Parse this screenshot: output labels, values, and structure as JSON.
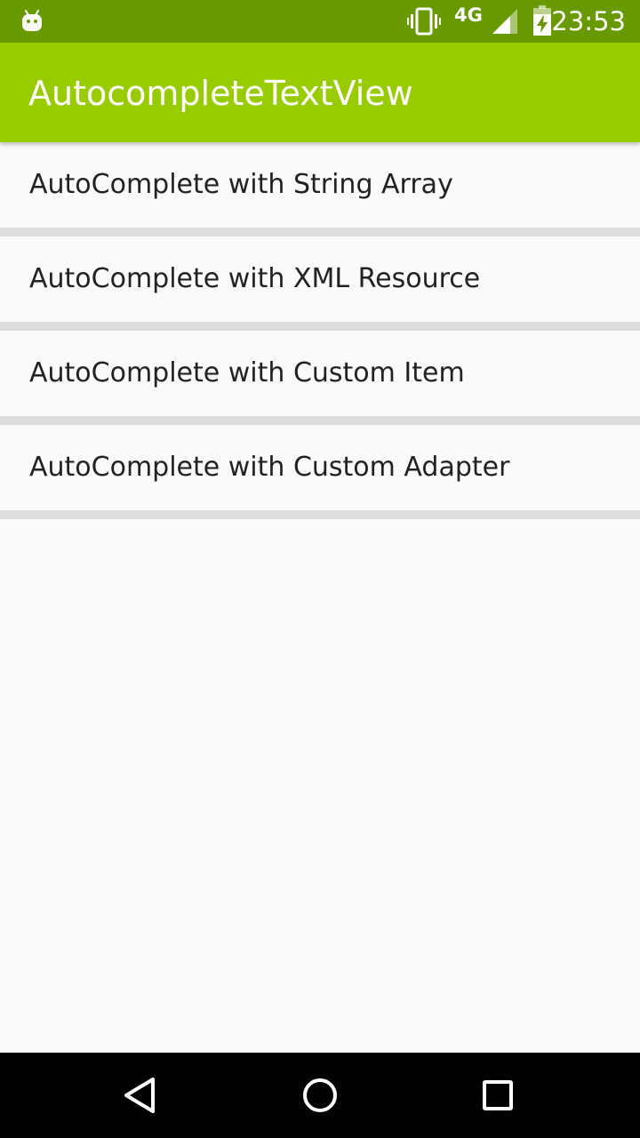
{
  "status_bar": {
    "network": "4G",
    "time": "23:53",
    "icons": [
      "android-icon",
      "vibrate-icon",
      "signal-icon",
      "battery-charging-icon"
    ]
  },
  "app_bar": {
    "title": "AutocompleteTextView"
  },
  "list": {
    "items": [
      {
        "label": "AutoComplete with String Array"
      },
      {
        "label": "AutoComplete with XML Resource"
      },
      {
        "label": "AutoComplete with Custom Item"
      },
      {
        "label": "AutoComplete with Custom Adapter"
      }
    ]
  },
  "nav_bar": {
    "icons": [
      "back-icon",
      "home-icon",
      "recents-icon"
    ]
  },
  "colors": {
    "status_bar": "#689a00",
    "app_bar": "#99cc00",
    "background": "#f9f9f9",
    "divider": "#dddddd",
    "nav_bar": "#000000"
  }
}
